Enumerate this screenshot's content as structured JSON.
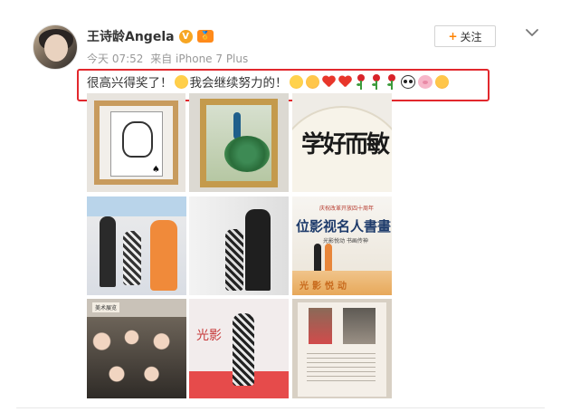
{
  "post": {
    "username": "王诗龄Angela",
    "vip_badge": "V",
    "level_badge": "🏅",
    "meta_time": "今天 07:52",
    "meta_source": "来自 iPhone 7 Plus",
    "text_part1": "很高兴得奖了！",
    "text_part2": "我会继续努力的！",
    "follow_label": "关注",
    "follow_plus": "+"
  },
  "images": {
    "calligraphy": "学好而敏",
    "event_board_title": "位影视名人書畫",
    "event_board_top": "庆祝改革开放四十周年",
    "event_board_sub": "光影悦动 书画传神",
    "event_board_bottom": "光影悦动",
    "crowd_sign": "美术展览",
    "wall_text": "光影"
  },
  "colors": {
    "accent_orange": "#ff8200",
    "highlight_red": "#e2282d"
  },
  "icons": [
    "vip-v-icon",
    "level-icon",
    "chevron-down-icon",
    "shy-emoji-icon",
    "grin-emoji-icon",
    "blush-emoji-icon",
    "heart-icon",
    "rose-icon",
    "panda-icon",
    "pig-icon",
    "kiss-emoji-icon"
  ]
}
